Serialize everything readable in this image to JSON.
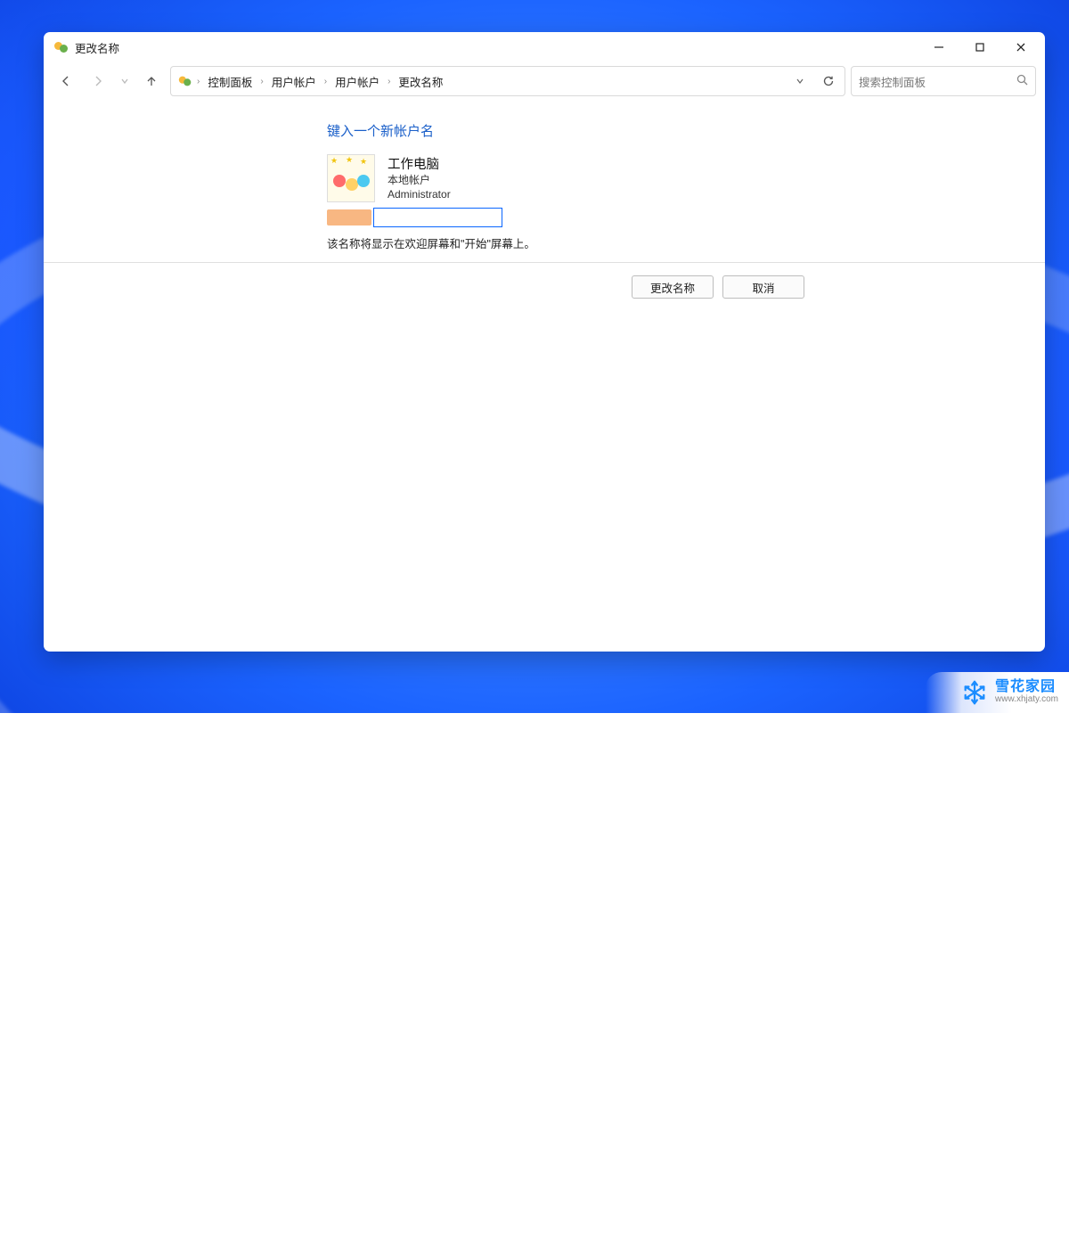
{
  "window": {
    "title": "更改名称"
  },
  "breadcrumbs": {
    "root": "控制面板",
    "l1": "用户帐户",
    "l2": "用户帐户",
    "l3": "更改名称"
  },
  "search": {
    "placeholder": "搜索控制面板"
  },
  "page": {
    "heading": "键入一个新帐户名",
    "account_name": "工作电脑",
    "account_type": "本地帐户",
    "account_role": "Administrator",
    "input_value": "",
    "hint": "该名称将显示在欢迎屏幕和\"开始\"屏幕上。"
  },
  "buttons": {
    "confirm": "更改名称",
    "cancel": "取消"
  },
  "watermark": {
    "name": "雪花家园",
    "url": "www.xhjaty.com"
  }
}
